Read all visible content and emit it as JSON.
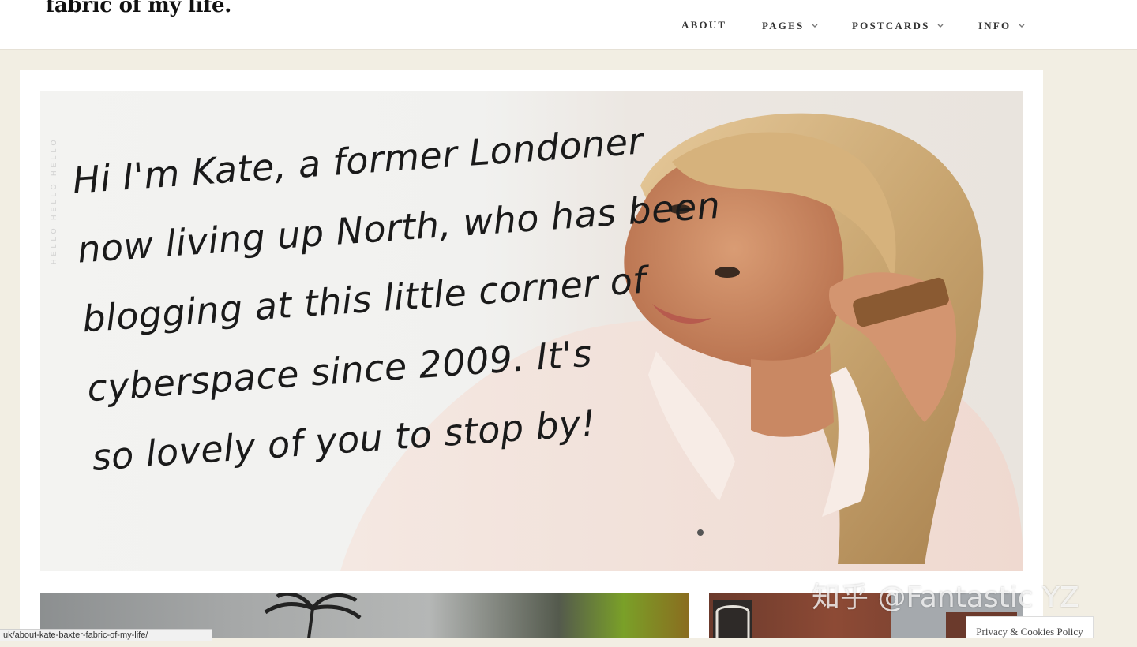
{
  "site": {
    "logo": "fabric of my life."
  },
  "nav": [
    {
      "label": "ABOUT",
      "has_dropdown": false
    },
    {
      "label": "PAGES",
      "has_dropdown": true
    },
    {
      "label": "POSTCARDS",
      "has_dropdown": true
    },
    {
      "label": "INFO",
      "has_dropdown": true
    }
  ],
  "hero": {
    "lines": [
      "Hi I'm Kate, a former Londoner",
      "now living up North, who has been",
      "blogging at this little corner of",
      "cyberspace since 2009. It's",
      "so lovely of you to stop by!"
    ],
    "side_text": "HELLO HELLO HELLO"
  },
  "watermark": "知乎 @Fantastic YZ",
  "status_bar": {
    "url": "uk/about-kate-baxter-fabric-of-my-life/"
  },
  "privacy_button": "Privacy & Cookies Policy",
  "colors": {
    "page_bg": "#f2eee3",
    "card_bg": "#ffffff",
    "text": "#1a1a1a"
  },
  "icons": {
    "dropdown": "chevron-down-icon"
  }
}
